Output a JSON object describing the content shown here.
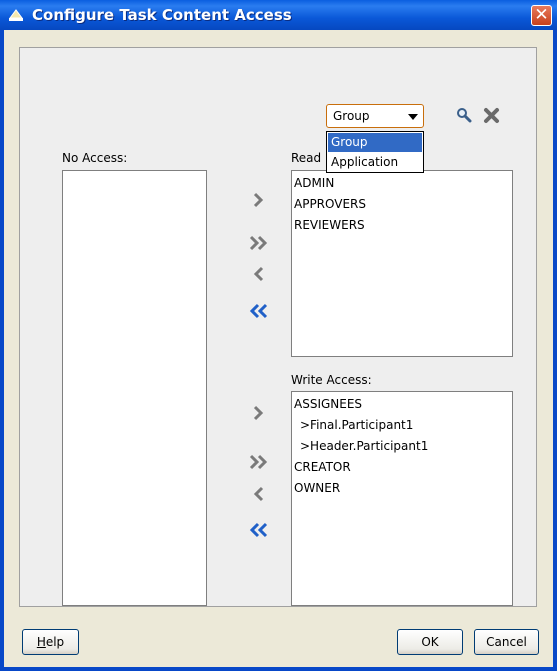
{
  "window": {
    "title": "Configure Task Content Access",
    "close_glyph": "✕"
  },
  "labels": {
    "no_access": "No Access:",
    "read_access": "Read",
    "write_access": "Write Access:"
  },
  "combo": {
    "selected": "Group",
    "options": [
      "Group",
      "Application"
    ],
    "highlighted_option": "Group"
  },
  "icons": {
    "search": "magnifier-icon",
    "clear": "x-icon"
  },
  "no_access_list": [],
  "read_access_list": [
    "ADMIN",
    "APPROVERS",
    "REVIEWERS"
  ],
  "write_access_list": [
    "ASSIGNEES",
    " >Final.Participant1",
    " >Header.Participant1",
    "CREATOR",
    "OWNER"
  ],
  "buttons": {
    "help_prefix": "",
    "help_mnemonic": "H",
    "help_rest": "elp",
    "ok": "OK",
    "cancel": "Cancel"
  },
  "colors": {
    "title_bar": "#0a5ee0",
    "selection": "#316ac5",
    "arrow_gray": "#7a7a7a",
    "arrow_blue": "#2060c8"
  }
}
